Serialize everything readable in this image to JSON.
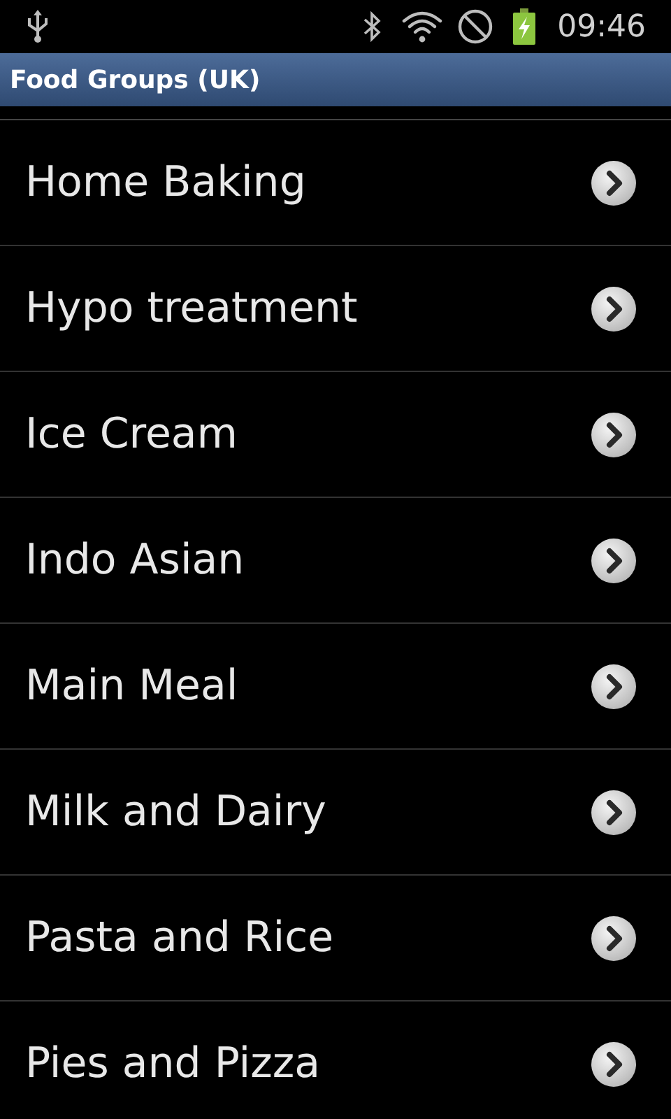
{
  "status_bar": {
    "time": "09:46"
  },
  "title_bar": {
    "title": "Food Groups (UK)"
  },
  "list": {
    "items": [
      {
        "label": "Home Baking"
      },
      {
        "label": "Hypo treatment"
      },
      {
        "label": "Ice Cream"
      },
      {
        "label": "Indo Asian"
      },
      {
        "label": "Main Meal"
      },
      {
        "label": "Milk and Dairy"
      },
      {
        "label": "Pasta and Rice"
      },
      {
        "label": "Pies and Pizza"
      }
    ]
  }
}
